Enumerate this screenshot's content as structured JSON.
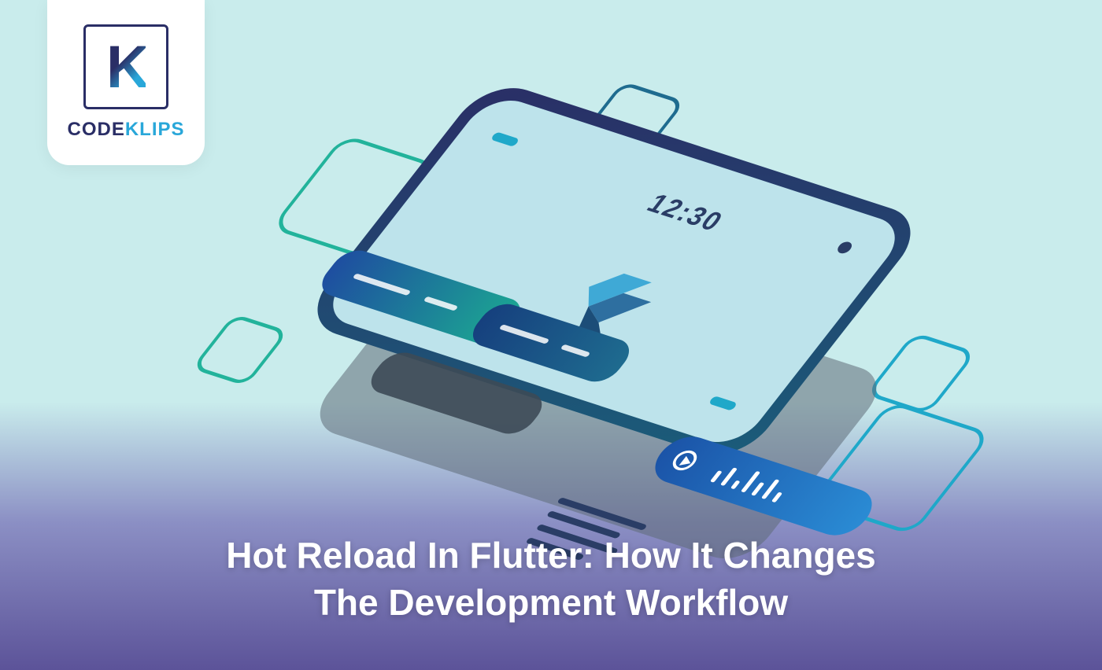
{
  "logo": {
    "code": "CODE",
    "klips": "KLIPS"
  },
  "phone": {
    "time": "12:30"
  },
  "heading": {
    "line1": "Hot Reload In Flutter: How It Changes",
    "line2": "The Development Workflow"
  }
}
